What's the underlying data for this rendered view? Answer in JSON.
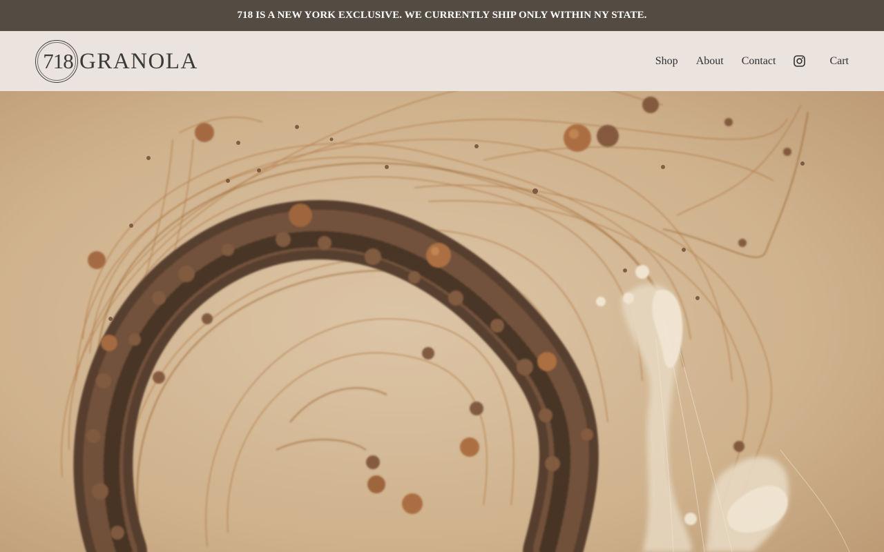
{
  "announcement": {
    "text": "718 IS A NEW YORK EXCLUSIVE. WE CURRENTLY SHIP ONLY WITHIN NY STATE."
  },
  "header": {
    "logo": {
      "number": "718",
      "word": "GRANOLA"
    },
    "nav": {
      "shop": "Shop",
      "about": "About",
      "contact": "Contact",
      "instagram_icon": "instagram-icon",
      "cart": "Cart"
    }
  },
  "hero": {
    "image_subject": "granola swirl artwork",
    "colors": {
      "background": "#d2b896",
      "caramel": "#b27a45",
      "granola": "#5a3d2b",
      "cream": "#efe4d2"
    }
  },
  "colors": {
    "announcement_bg": "#544b42",
    "header_bg": "#ebe3dd",
    "text_dark": "#2f2f2f"
  }
}
